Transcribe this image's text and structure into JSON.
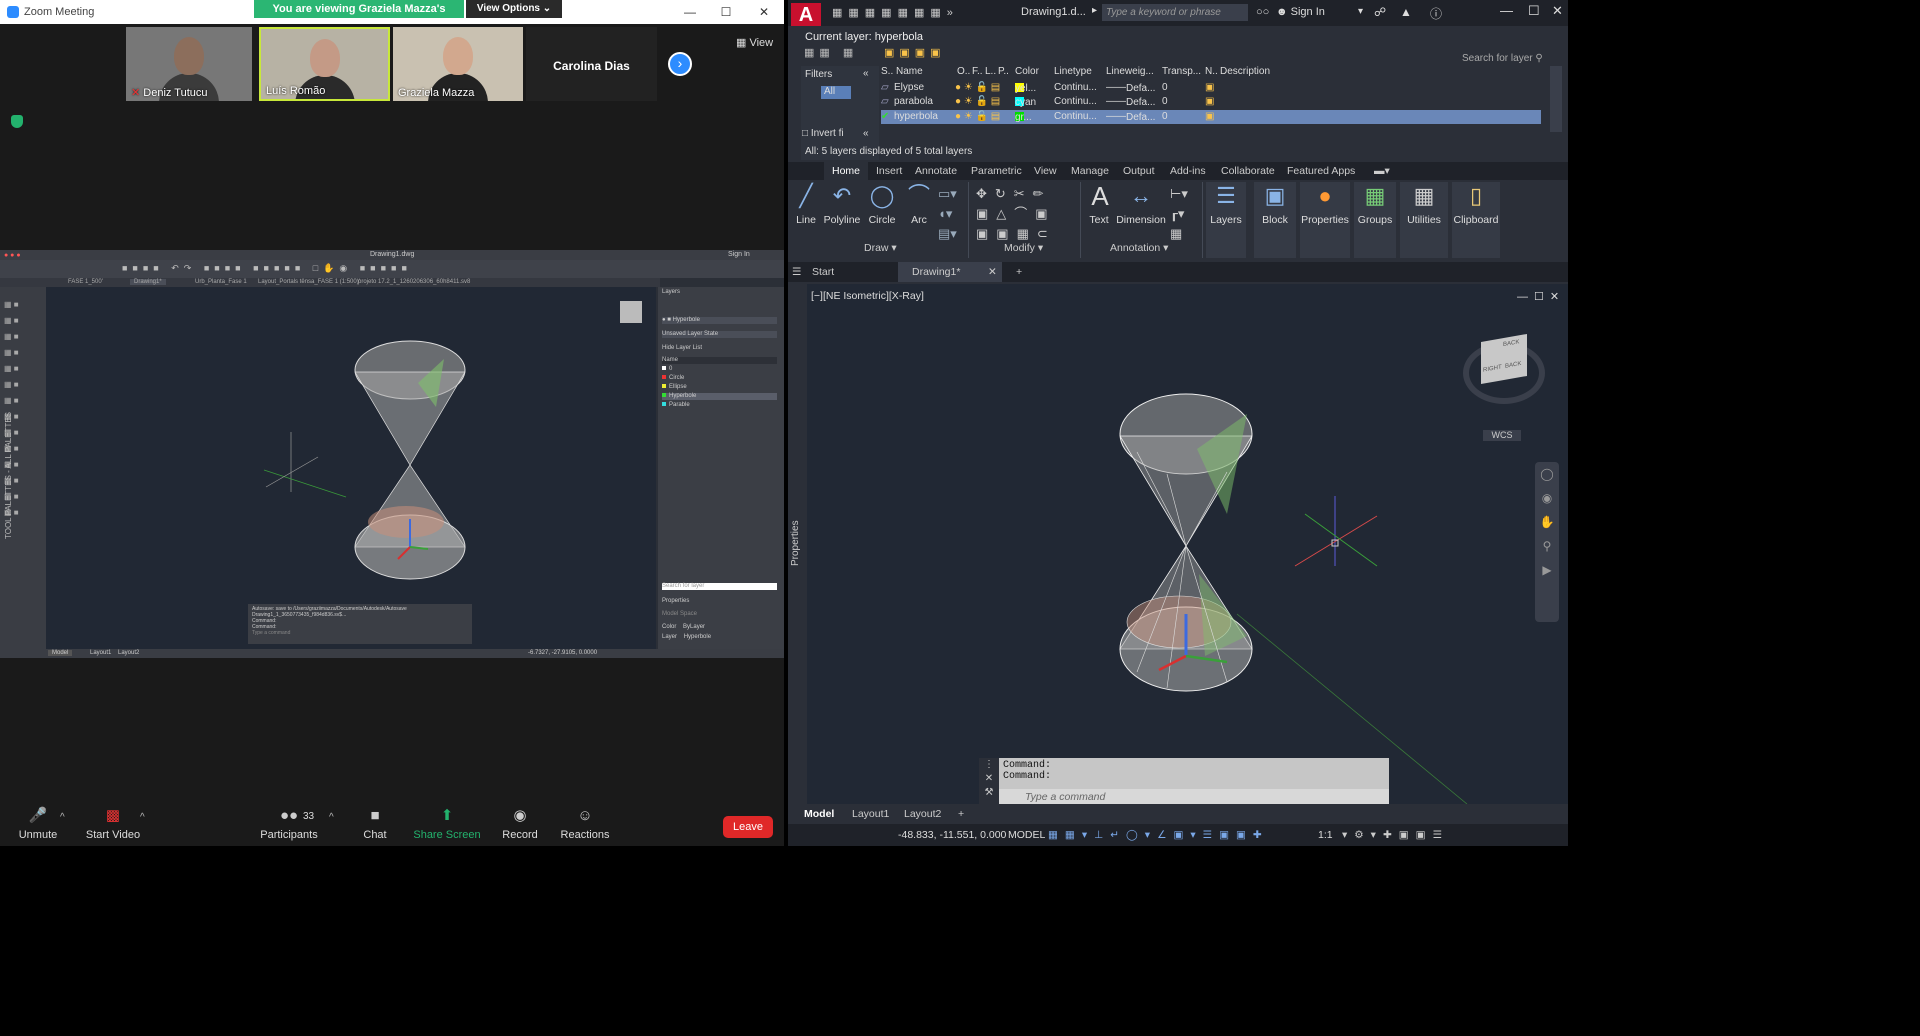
{
  "zoom": {
    "title": "Zoom Meeting",
    "banner": "You are viewing Graziela Mazza's screen",
    "view_options": "View Options",
    "view_label": "View",
    "participants": [
      {
        "name": "Deniz Tutucu"
      },
      {
        "name": "Luís Romão"
      },
      {
        "name": "Graziela Mazza"
      },
      {
        "name": "Carolina Dias"
      }
    ],
    "toolbar": {
      "unmute": "Unmute",
      "start_video": "Start Video",
      "participants": "Participants",
      "participants_count": "33",
      "chat": "Chat",
      "share_screen": "Share Screen",
      "record": "Record",
      "reactions": "Reactions",
      "leave": "Leave"
    },
    "shared": {
      "title": "Drawing1.dwg",
      "sign_in": "Sign In",
      "tabs": [
        "FASE 1_500'",
        "Drawing1*",
        "Urb_Planta_Fase 1",
        "Layout_Portals tênsa_FASE 1 (1:500)'",
        "projeto 17.2_1_1260206306_60h8411.sv8"
      ],
      "layers_title": "Layers",
      "current_layer": "Hyperbole",
      "layer_state": "Unsaved Layer State",
      "hide_layer_list": "Hide Layer List",
      "name_header": "Name",
      "layers": [
        "0",
        "Circle",
        "Ellipse",
        "Hyperbole",
        "Parable"
      ],
      "search_placeholder": "Search for layer",
      "properties_title": "Properties",
      "model_space": "Model Space",
      "color_label": "Color",
      "color_value": "ByLayer",
      "layer_label": "Layer",
      "layer_value": "Hyperbole",
      "cmd_lines": [
        "Autosave: save to /Users/graziimazza/Documents/Autodesk/Autosave",
        "Drawing1_1_3650773435_f984d836.sv$...",
        "Command:",
        "Command:"
      ],
      "cmd_placeholder": "Type a command",
      "coords": "-6.7327, -27.9105, 0.0000",
      "model_tabs": [
        "Model",
        "Layout1",
        "Layout2"
      ],
      "palette_label": "TOOL PALETTES - ALL PALETTES"
    }
  },
  "acad": {
    "file_title": "Drawing1.d...",
    "search_placeholder": "Type a keyword or phrase",
    "sign_in": "Sign In",
    "current_layer": "Current layer: hyperbola",
    "search_layer": "Search for layer",
    "filters": "Filters",
    "filter_all": "All",
    "invert_filter": "Invert fi",
    "columns": [
      "S..",
      "Name",
      "O..",
      "F..",
      "L..",
      "P..",
      "Color",
      "Linetype",
      "Lineweig...",
      "Transp...",
      "N..",
      "Description"
    ],
    "layers": [
      {
        "name": "Elypse",
        "color": "yel...",
        "swatch": "#ffff00",
        "linetype": "Continu...",
        "lineweight": "Defa...",
        "transparency": "0"
      },
      {
        "name": "parabola",
        "color": "cyan",
        "swatch": "#00ffff",
        "linetype": "Continu...",
        "lineweight": "Defa...",
        "transparency": "0"
      },
      {
        "name": "hyperbola",
        "color": "gr...",
        "swatch": "#00dd00",
        "linetype": "Continu...",
        "lineweight": "Defa...",
        "transparency": "0"
      }
    ],
    "layer_footer": "All: 5 layers displayed of 5 total layers",
    "ribbon_tabs": [
      "Home",
      "Insert",
      "Annotate",
      "Parametric",
      "View",
      "Manage",
      "Output",
      "Add-ins",
      "Collaborate",
      "Featured Apps"
    ],
    "ribbon": {
      "line": "Line",
      "polyline": "Polyline",
      "circle": "Circle",
      "arc": "Arc",
      "text": "Text",
      "dimension": "Dimension",
      "layers": "Layers",
      "block": "Block",
      "properties": "Properties",
      "groups": "Groups",
      "utilities": "Utilities",
      "clipboard": "Clipboard",
      "draw": "Draw",
      "modify": "Modify",
      "annotation": "Annotation"
    },
    "file_tabs": [
      "Start",
      "Drawing1*"
    ],
    "viewport_label": "[−][NE Isometric][X-Ray]",
    "properties_side": "Properties",
    "wcs": "WCS",
    "cube_labels": [
      "BACK",
      "RIGHT",
      "BACK"
    ],
    "command_history": [
      "Command:",
      "Command:"
    ],
    "command_placeholder": "Type a command",
    "layout_tabs": [
      "Model",
      "Layout1",
      "Layout2"
    ],
    "coords": "-48.833, -11.551, 0.000",
    "model_label": "MODEL",
    "scale": "1:1"
  }
}
